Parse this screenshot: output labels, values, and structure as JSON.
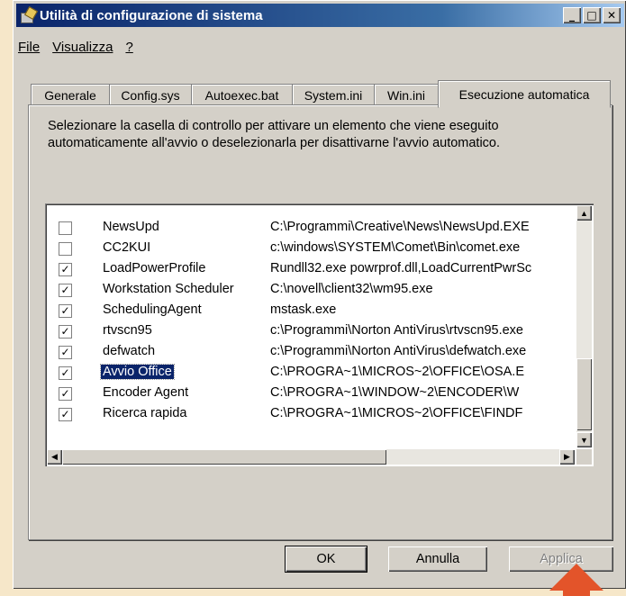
{
  "window": {
    "title": "Utilità di configurazione di sistema"
  },
  "menu": [
    {
      "label": "File"
    },
    {
      "label": "Visualizza"
    },
    {
      "label": "?"
    }
  ],
  "tabs": [
    {
      "label": "Generale"
    },
    {
      "label": "Config.sys"
    },
    {
      "label": "Autoexec.bat"
    },
    {
      "label": "System.ini"
    },
    {
      "label": "Win.ini"
    },
    {
      "label": "Esecuzione automatica",
      "active": true
    }
  ],
  "description": "Selezionare la casella di controllo per attivare un elemento che viene eseguito automaticamente all'avvio o deselezionarla per disattivarne l'avvio automatico.",
  "startup_items": [
    {
      "checked": false,
      "name": "NewsUpd",
      "path": "C:\\Programmi\\Creative\\News\\NewsUpd.EXE"
    },
    {
      "checked": false,
      "name": "CC2KUI",
      "path": "c:\\windows\\SYSTEM\\Comet\\Bin\\comet.exe"
    },
    {
      "checked": true,
      "name": "LoadPowerProfile",
      "path": "Rundll32.exe powrprof.dll,LoadCurrentPwrSc"
    },
    {
      "checked": true,
      "name": "Workstation Scheduler",
      "path": "C:\\novell\\client32\\wm95.exe"
    },
    {
      "checked": true,
      "name": "SchedulingAgent",
      "path": "mstask.exe"
    },
    {
      "checked": true,
      "name": "rtvscn95",
      "path": "c:\\Programmi\\Norton AntiVirus\\rtvscn95.exe"
    },
    {
      "checked": true,
      "name": "defwatch",
      "path": "c:\\Programmi\\Norton AntiVirus\\defwatch.exe"
    },
    {
      "checked": true,
      "name": "Avvio Office",
      "path": "C:\\PROGRA~1\\MICROS~2\\OFFICE\\OSA.E",
      "selected": true
    },
    {
      "checked": true,
      "name": "Encoder Agent",
      "path": "C:\\PROGRA~1\\WINDOW~2\\ENCODER\\W"
    },
    {
      "checked": true,
      "name": "Ricerca rapida",
      "path": "C:\\PROGRA~1\\MICROS~2\\OFFICE\\FINDF"
    }
  ],
  "buttons": {
    "ok": "OK",
    "cancel": "Annulla",
    "apply": "Applica"
  },
  "colors": {
    "titlebar": "#0a246a",
    "selection": "#0a246a",
    "annotation_arrow": "#e3542a"
  }
}
